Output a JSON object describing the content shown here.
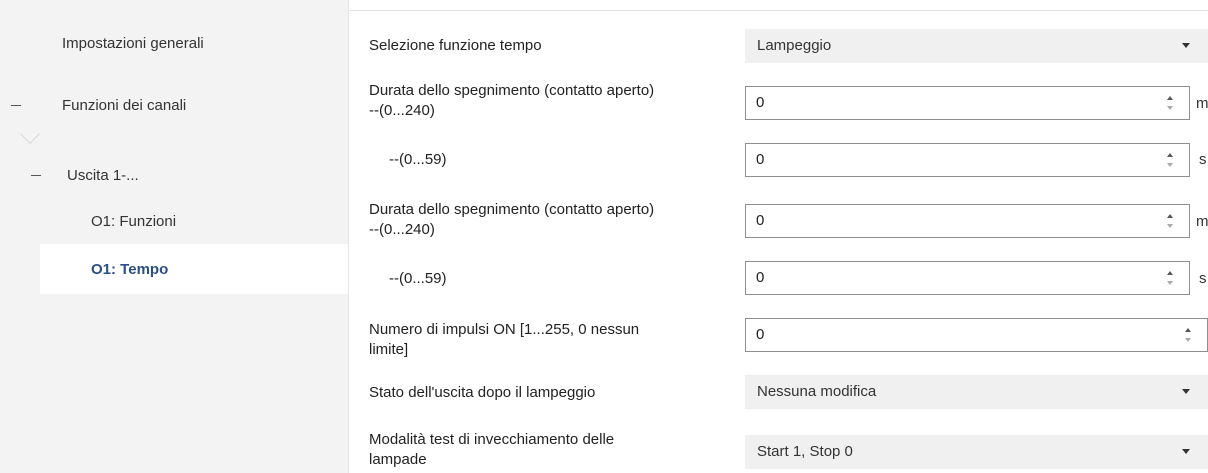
{
  "sidebar": {
    "items": [
      {
        "label": "Impostazioni generali"
      },
      {
        "label": "Funzioni dei canali",
        "toggle": "–"
      },
      {
        "label": "Uscita 1-...",
        "toggle": "–"
      },
      {
        "label": "O1: Funzioni"
      },
      {
        "label": "O1: Tempo",
        "selected": true
      }
    ]
  },
  "form": {
    "time_function": {
      "label": "Selezione funzione tempo",
      "value": "Lampeggio"
    },
    "off_duration_1": {
      "label_line1": "Durata dello spegnimento (contatto aperto)",
      "label_line2": "--(0...240)",
      "value": "0",
      "unit": "min"
    },
    "off_duration_1_seconds": {
      "label": "--(0...59)",
      "value": "0",
      "unit": "s"
    },
    "off_duration_2": {
      "label_line1": "Durata dello spegnimento (contatto aperto)",
      "label_line2": "--(0...240)",
      "value": "0",
      "unit": "min"
    },
    "off_duration_2_seconds": {
      "label": "--(0...59)",
      "value": "0",
      "unit": "s"
    },
    "pulse_count": {
      "label_line1": "Numero di impulsi ON [1...255, 0 nessun",
      "label_line2": "limite]",
      "value": "0"
    },
    "output_state": {
      "label": "Stato dell'uscita dopo il lampeggio",
      "value": "Nessuna modifica"
    },
    "aging_test": {
      "label_line1": "Modalità test di invecchiamento delle",
      "label_line2": "lampade",
      "value": "Start 1, Stop 0"
    }
  },
  "colors": {
    "sidebar_bg": "#f3f3f3",
    "selected_text": "#2a4f8a",
    "select_bg": "#f0f0f0",
    "input_border": "#8f8f8f"
  },
  "icons": {
    "dropdown": "chevron-down-icon",
    "spin_up": "arrow-up-icon",
    "spin_down": "arrow-down-icon",
    "collapse": "collapse-dash-icon"
  }
}
